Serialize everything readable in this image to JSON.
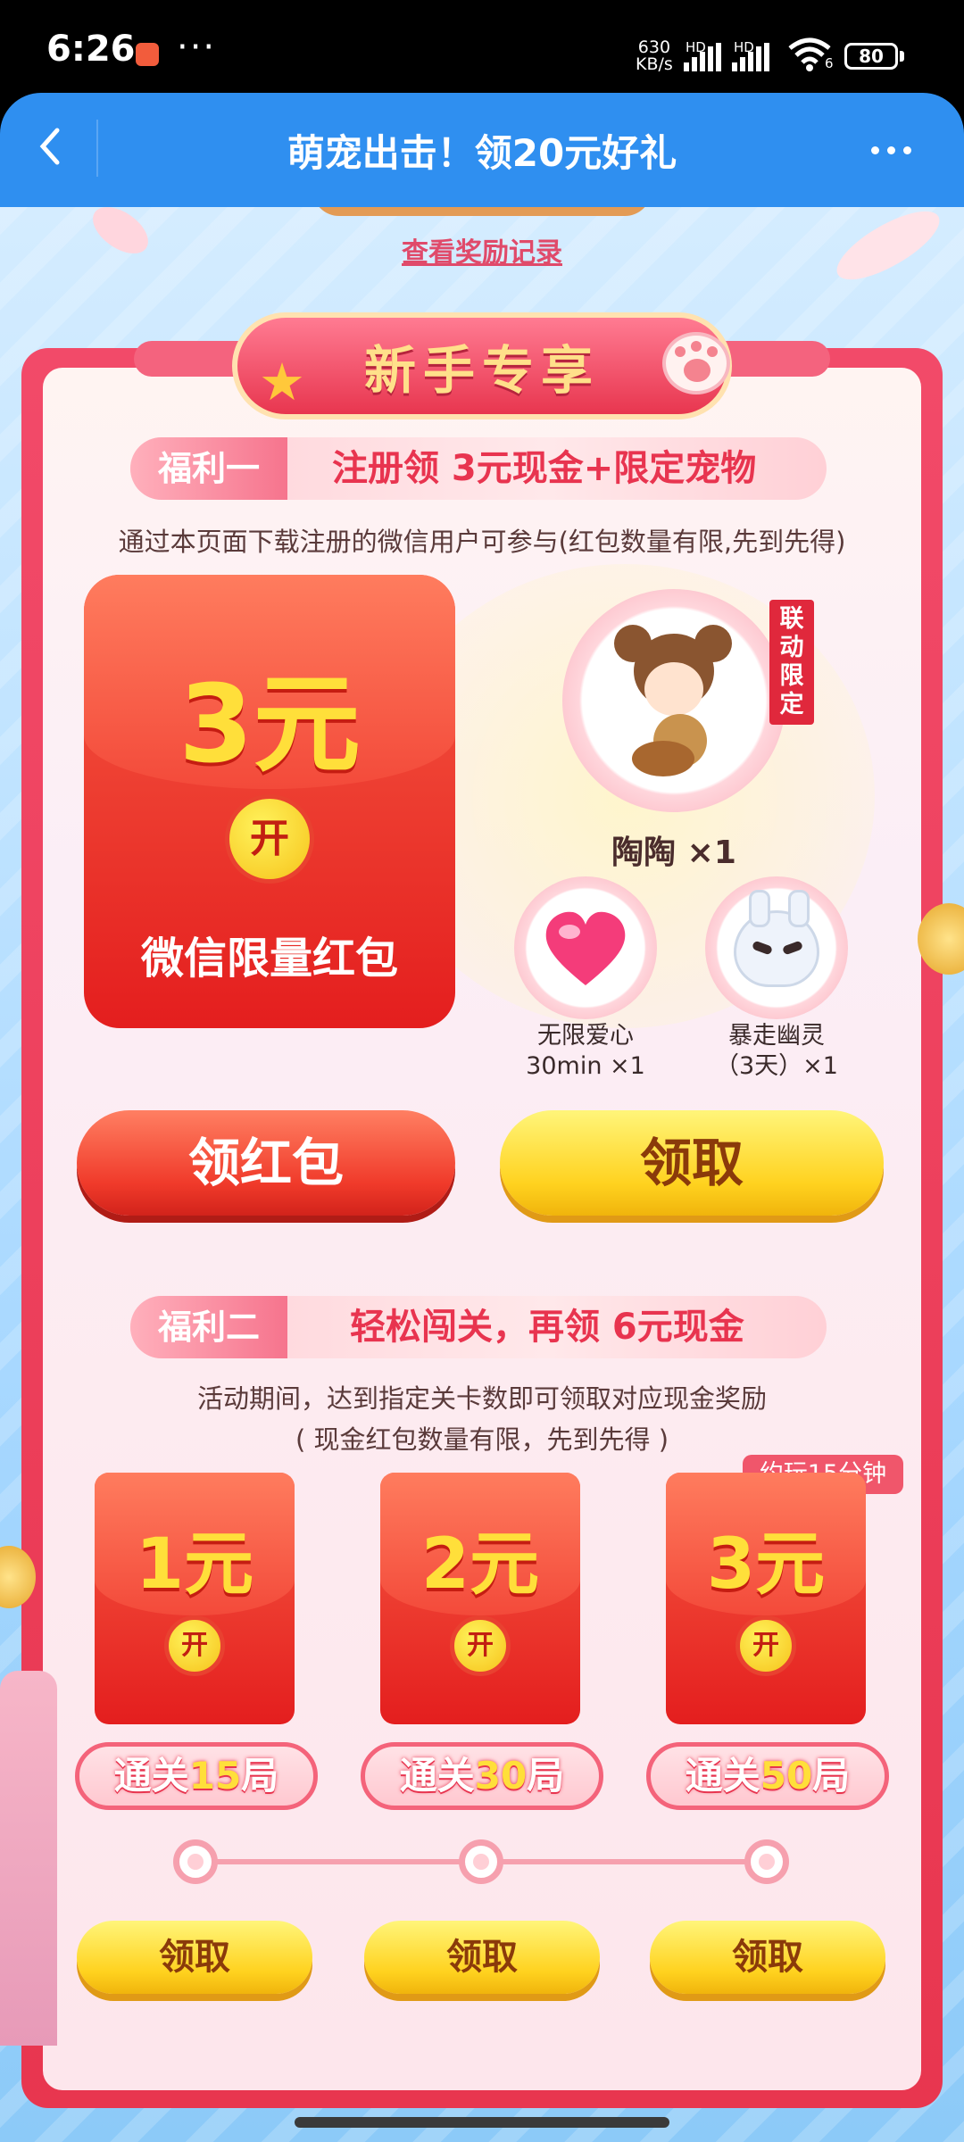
{
  "status_bar": {
    "time": "6:26",
    "speed_value": "630",
    "speed_unit": "KB/s",
    "sim1": "HD",
    "sim2": "HD",
    "wifi_sub": "6",
    "battery": "80"
  },
  "header": {
    "title": "萌宠出击！领20元好礼"
  },
  "record_link": "查看奖励记录",
  "banner": "新手专享",
  "welfare1": {
    "tag": "福利一",
    "title": "注册领 3元现金+限定宠物",
    "note": "通过本页面下载注册的微信用户可参与(红包数量有限,先到先得)",
    "packet": {
      "amount": "3元",
      "open": "开",
      "label": "微信限量红包"
    },
    "pet": {
      "name": "陶陶 ×1",
      "ribbon": "联动限定"
    },
    "items": [
      {
        "name": "无限爱心",
        "detail": "30min ×1"
      },
      {
        "name": "暴走幽灵",
        "detail": "（3天）×1"
      }
    ],
    "btn_packet": "领红包",
    "btn_claim": "领取"
  },
  "welfare2": {
    "tag": "福利二",
    "title": "轻松闯关，再领 6元现金",
    "note1": "活动期间，达到指定关卡数即可领取对应现金奖励",
    "note2": "( 现金红包数量有限，先到先得 )",
    "badge": "约玩15分钟",
    "packets": [
      {
        "amount": "1元",
        "open": "开",
        "pre": "通关",
        "num": "15",
        "post": "局",
        "btn": "领取"
      },
      {
        "amount": "2元",
        "open": "开",
        "pre": "通关",
        "num": "30",
        "post": "局",
        "btn": "领取"
      },
      {
        "amount": "3元",
        "open": "开",
        "pre": "通关",
        "num": "50",
        "post": "局",
        "btn": "领取"
      }
    ]
  },
  "colors": {
    "header": "#2f8ff0",
    "frame": "#e8364f",
    "gold": "#ffdf3a"
  }
}
